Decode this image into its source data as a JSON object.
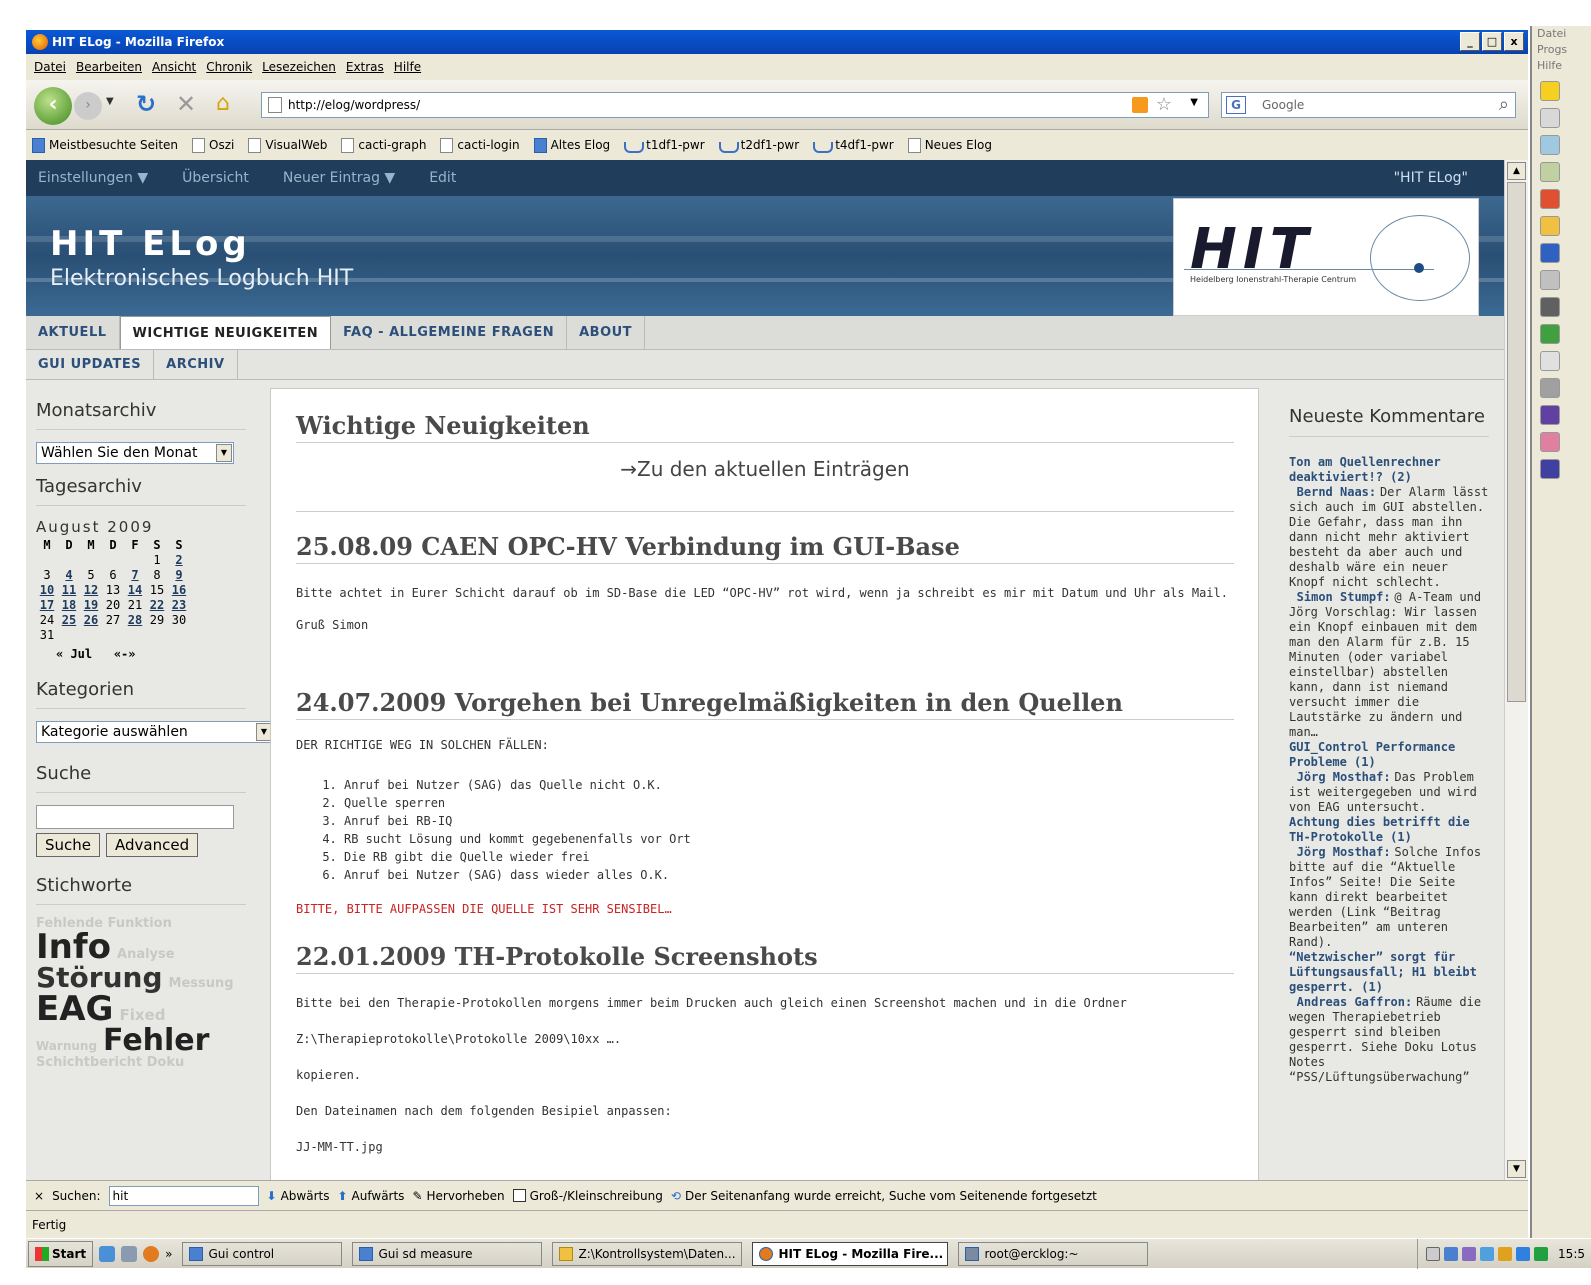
{
  "window": {
    "title": "HIT ELog - Mozilla Firefox",
    "min": "_",
    "max": "□",
    "close": "x"
  },
  "menu": [
    "Datei",
    "Bearbeiten",
    "Ansicht",
    "Chronik",
    "Lesezeichen",
    "Extras",
    "Hilfe"
  ],
  "nav": {
    "url": "http://elog/wordpress/",
    "search_placeholder": "Google"
  },
  "bookmarks": [
    "Meistbesuchte Seiten",
    "Oszi",
    "VisualWeb",
    "cacti-graph",
    "cacti-login",
    "Altes Elog",
    "t1df1-pwr",
    "t2df1-pwr",
    "t4df1-pwr",
    "Neues Elog"
  ],
  "wp_bar": {
    "items": [
      "Einstellungen ▼",
      "Übersicht",
      "Neuer Eintrag ▼",
      "Edit"
    ],
    "right": "\"HIT ELog\""
  },
  "header": {
    "title": "HIT ELog",
    "subtitle": "Elektronisches Logbuch HIT",
    "logo_text": "HIT",
    "logo_caption": "Heidelberg Ionenstrahl-Therapie Centrum"
  },
  "tabs_row1": [
    "AKTUELL",
    "WICHTIGE NEUIGKEITEN",
    "FAQ - ALLGEMEINE FRAGEN",
    "ABOUT"
  ],
  "tabs_row2": [
    "GUI UPDATES",
    "ARCHIV"
  ],
  "left": {
    "monatsarchiv": "Monatsarchiv",
    "monat_select": "Wählen Sie den Monat",
    "tagesarchiv": "Tagesarchiv",
    "cal_month": "August 2009",
    "cal_days": [
      "M",
      "D",
      "M",
      "D",
      "F",
      "S",
      "S"
    ],
    "cal_rows": [
      [
        "",
        "",
        "",
        "",
        "",
        "1",
        "2"
      ],
      [
        "3",
        "4",
        "5",
        "6",
        "7",
        "8",
        "9"
      ],
      [
        "10",
        "11",
        "12",
        "13",
        "14",
        "15",
        "16"
      ],
      [
        "17",
        "18",
        "19",
        "20",
        "21",
        "22",
        "23"
      ],
      [
        "24",
        "25",
        "26",
        "27",
        "28",
        "29",
        "30"
      ],
      [
        "31",
        "",
        "",
        "",
        "",
        "",
        ""
      ]
    ],
    "cal_prev": "« Jul",
    "cal_next": "«-»",
    "kategorien": "Kategorien",
    "kategorie_select": "Kategorie auswählen",
    "suche": "Suche",
    "suche_btn": "Suche",
    "advanced_btn": "Advanced",
    "stichworte": "Stichworte",
    "tags": [
      {
        "t": "Fehlende Funktion",
        "s": 13,
        "c": "#c8c8c8"
      },
      {
        "t": "Info",
        "s": 34,
        "c": "#222"
      },
      {
        "t": "Analyse",
        "s": 13,
        "c": "#c8c8c8"
      },
      {
        "t": "Störung",
        "s": 28,
        "c": "#333"
      },
      {
        "t": "Messung",
        "s": 13,
        "c": "#c8c8c8"
      },
      {
        "t": "EAG",
        "s": 34,
        "c": "#222"
      },
      {
        "t": "Fixed",
        "s": 15,
        "c": "#c8c8c8"
      },
      {
        "t": "Warnung",
        "s": 12,
        "c": "#c8c8c8"
      },
      {
        "t": "Fehler",
        "s": 30,
        "c": "#222"
      },
      {
        "t": "Schichtbericht Doku",
        "s": 13,
        "c": "#c8c8c8"
      }
    ]
  },
  "main": {
    "page_title": "Wichtige Neuigkeiten",
    "current_link": "→Zu den aktuellen Einträgen",
    "posts": [
      {
        "title": "25.08.09 CAEN OPC-HV Verbindung im GUI-Base",
        "p1": "Bitte achtet in Eurer Schicht darauf ob im SD-Base die LED “OPC-HV” rot wird, wenn ja schreibt es mir mit Datum und Uhr als Mail.",
        "p2": "Gruß Simon"
      },
      {
        "title": "24.07.2009 Vorgehen bei Unregelmäßigkeiten in den Quellen",
        "intro": "DER RICHTIGE WEG IN SOLCHEN FÄLLEN:",
        "items": [
          "Anruf bei Nutzer (SAG) das Quelle nicht O.K.",
          "Quelle sperren",
          "Anruf bei RB-IQ",
          "RB sucht Lösung und kommt gegebenenfalls vor Ort",
          "Die RB gibt die Quelle wieder frei",
          "Anruf bei Nutzer (SAG) dass wieder alles O.K."
        ],
        "warning": "BITTE, BITTE AUFPASSEN DIE QUELLE IST SEHR SENSIBEL…"
      },
      {
        "title": "22.01.2009 TH-Protokolle Screenshots",
        "p1": "Bitte bei den Therapie-Protokollen morgens immer beim Drucken auch gleich einen Screenshot machen und in die Ordner",
        "p2": "Z:\\Therapieprotokolle\\Protokolle 2009\\10xx ….",
        "p3": "kopieren.",
        "p4": "Den Dateinamen nach dem folgenden Besipiel anpassen:",
        "p5": "JJ-MM-TT.jpg"
      }
    ]
  },
  "right": {
    "heading": "Neueste Kommentare",
    "comments": [
      {
        "post": "Ton am Quellenrechner deaktiviert!? (2)",
        "author": "Bernd Naas:",
        "text": "Der Alarm lässt sich auch im GUI abstellen. Die Gefahr, dass man ihn dann nicht mehr aktiviert besteht da aber auch und deshalb wäre ein neuer Knopf nicht schlecht."
      },
      {
        "post": "",
        "author": "Simon Stumpf:",
        "text": "@ A-Team und Jörg Vorschlag: Wir lassen ein Knopf einbauen mit dem man den Alarm für z.B. 15 Minuten (oder variabel einstellbar) abstellen kann, dann ist niemand versucht immer die Lautstärke zu ändern und man…"
      },
      {
        "post": "GUI_Control Performance Probleme (1)",
        "author": "Jörg Mosthaf:",
        "text": "Das Problem ist weitergegeben und wird von EAG untersucht."
      },
      {
        "post": "Achtung dies betrifft die TH-Protokolle (1)",
        "author": "Jörg Mosthaf:",
        "text": "Solche Infos bitte auf die “Aktuelle Infos” Seite! Die Seite kann direkt bearbeitet werden (Link “Beitrag Bearbeiten” am unteren Rand)."
      },
      {
        "post": "“Netzwischer” sorgt für Lüftungsausfall; H1 bleibt gesperrt. (1)",
        "author": "Andreas Gaffron:",
        "text": "Räume die wegen Therapiebetrieb gesperrt sind bleiben gesperrt. Siehe Doku Lotus Notes “PSS/Lüftungsüberwachung”"
      }
    ]
  },
  "findbar": {
    "close": "×",
    "label": "Suchen:",
    "value": "hit",
    "down": "Abwärts",
    "up": "Aufwärts",
    "highlight": "Hervorheben",
    "case": "Groß-/Kleinschreibung",
    "status": "Der Seitenanfang wurde erreicht, Suche vom Seitenende fortgesetzt"
  },
  "status": "Fertig",
  "taskbar": {
    "start": "Start",
    "more": "»",
    "items": [
      "Gui control",
      "Gui sd measure",
      "Z:\\Kontrollsystem\\Daten...",
      "HIT ELog - Mozilla Fire...",
      "root@ercklog:~"
    ],
    "clock": "15:5"
  },
  "rightstrip": [
    "Datei",
    "Progs",
    "Hilfe"
  ]
}
